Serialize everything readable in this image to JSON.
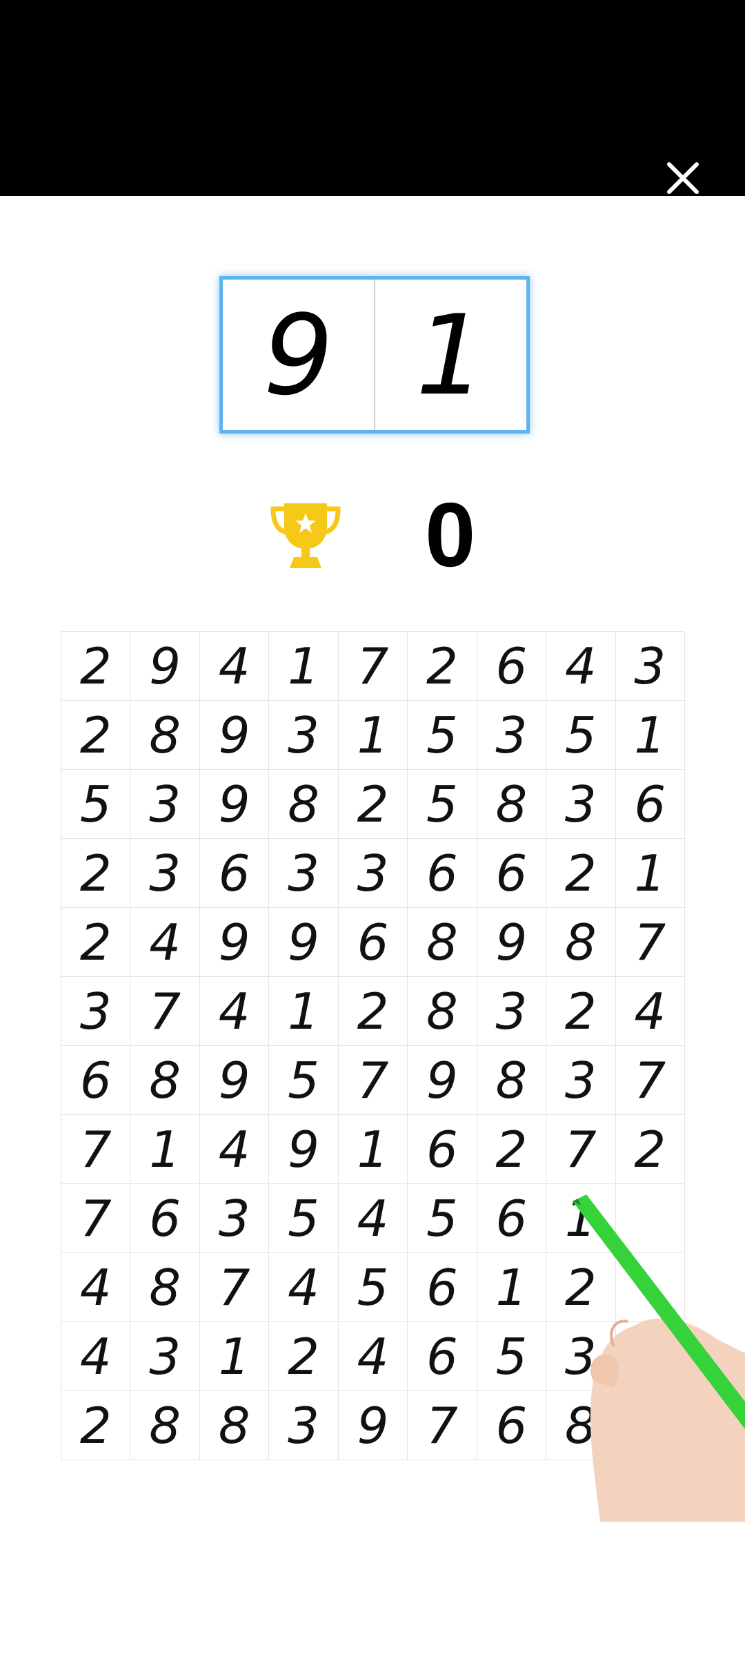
{
  "target": {
    "digits": [
      "9",
      "1"
    ]
  },
  "score": {
    "value": "0",
    "icon": "trophy-icon",
    "icon_color": "#f6c818"
  },
  "close": {
    "icon": "close-icon"
  },
  "grid": {
    "rows": [
      [
        "2",
        "9",
        "4",
        "1",
        "7",
        "2",
        "6",
        "4",
        "3"
      ],
      [
        "2",
        "8",
        "9",
        "3",
        "1",
        "5",
        "3",
        "5",
        "1"
      ],
      [
        "5",
        "3",
        "9",
        "8",
        "2",
        "5",
        "8",
        "3",
        "6"
      ],
      [
        "2",
        "3",
        "6",
        "3",
        "3",
        "6",
        "6",
        "2",
        "1"
      ],
      [
        "2",
        "4",
        "9",
        "9",
        "6",
        "8",
        "9",
        "8",
        "7"
      ],
      [
        "3",
        "7",
        "4",
        "1",
        "2",
        "8",
        "3",
        "2",
        "4"
      ],
      [
        "6",
        "8",
        "9",
        "5",
        "7",
        "9",
        "8",
        "3",
        "7"
      ],
      [
        "7",
        "1",
        "4",
        "9",
        "1",
        "6",
        "2",
        "7",
        "2"
      ],
      [
        "7",
        "6",
        "3",
        "5",
        "4",
        "5",
        "6",
        "1",
        ""
      ],
      [
        "4",
        "8",
        "7",
        "4",
        "5",
        "6",
        "1",
        "2",
        ""
      ],
      [
        "4",
        "3",
        "1",
        "2",
        "4",
        "6",
        "5",
        "3",
        ""
      ],
      [
        "2",
        "8",
        "8",
        "3",
        "9",
        "7",
        "6",
        "8",
        ""
      ]
    ]
  },
  "colors": {
    "highlight": "#5fb4ee",
    "pen": "#36d23a"
  }
}
